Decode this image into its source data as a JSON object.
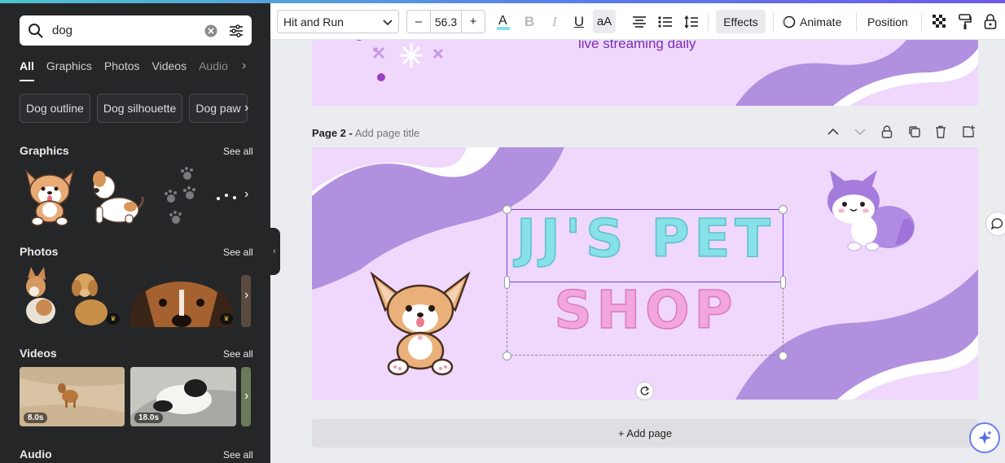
{
  "left_panel": {
    "search": {
      "value": "dog"
    },
    "tabs": [
      {
        "label": "All"
      },
      {
        "label": "Graphics"
      },
      {
        "label": "Photos"
      },
      {
        "label": "Videos"
      },
      {
        "label": "Audio"
      }
    ],
    "chips": [
      {
        "label": "Dog outline"
      },
      {
        "label": "Dog silhouette"
      },
      {
        "label": "Dog paw"
      }
    ],
    "sections": {
      "graphics": {
        "title": "Graphics",
        "see_all": "See all"
      },
      "photos": {
        "title": "Photos",
        "see_all": "See all"
      },
      "videos": {
        "title": "Videos",
        "see_all": "See all",
        "durations": [
          "8.0s",
          "18.0s"
        ]
      },
      "audio": {
        "title": "Audio",
        "see_all": "See all"
      }
    }
  },
  "toolbar": {
    "font_name": "Hit and Run",
    "font_size": "56.3",
    "minus": "–",
    "plus": "+",
    "effects_label": "Effects",
    "animate_label": "Animate",
    "position_label": "Position"
  },
  "canvas": {
    "page1_text": "live streaming daily",
    "page2_label": "Page 2 -",
    "page2_title_placeholder": "Add page title",
    "title_line1": "JJ'S PET",
    "title_line2": "SHOP",
    "add_page_label": "+ Add page"
  },
  "colors": {
    "canvas_bg": "#efd8fb",
    "wave_purple": "#b290e0",
    "title_cyan": "#86e1e8",
    "title_pink": "#f2a6dd",
    "selection": "#7b3dea"
  }
}
